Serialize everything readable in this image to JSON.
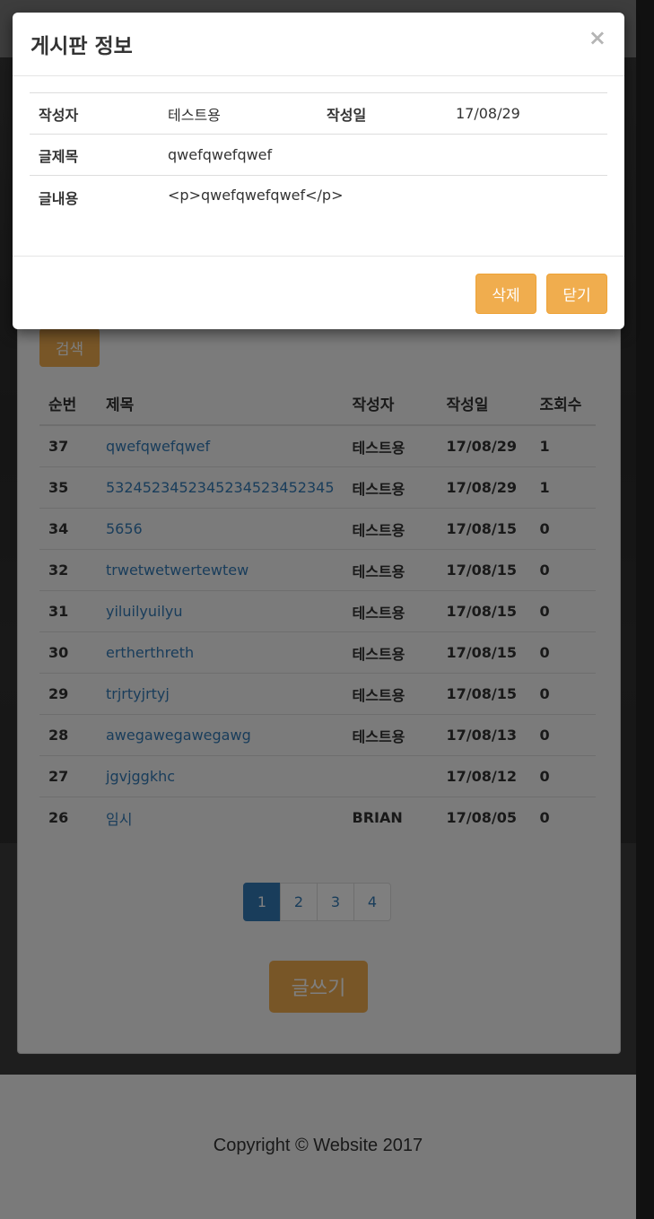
{
  "modal": {
    "title": "게시판 정보",
    "close_label": "×",
    "labels": {
      "writer": "작성자",
      "date": "작성일",
      "subject": "글제목",
      "content": "글내용"
    },
    "values": {
      "writer": "테스트용",
      "date": "17/08/29",
      "subject": "qwefqwefqwef",
      "content": "<p>qwefqwefqwef</p>"
    },
    "delete_label": "삭제",
    "close_button_label": "닫기"
  },
  "board": {
    "search_label": "검색",
    "columns": [
      "순번",
      "제목",
      "작성자",
      "작성일",
      "조회수"
    ],
    "rows": [
      [
        "37",
        "qwefqwefqwef",
        "테스트용",
        "17/08/29",
        "1"
      ],
      [
        "35",
        "5324523452345234523452345",
        "테스트용",
        "17/08/29",
        "1"
      ],
      [
        "34",
        "5656",
        "테스트용",
        "17/08/15",
        "0"
      ],
      [
        "32",
        "trwetwetwertewtew",
        "테스트용",
        "17/08/15",
        "0"
      ],
      [
        "31",
        "yiluilyuilyu",
        "테스트용",
        "17/08/15",
        "0"
      ],
      [
        "30",
        "ertherthreth",
        "테스트용",
        "17/08/15",
        "0"
      ],
      [
        "29",
        "trjrtyjrtyj",
        "테스트용",
        "17/08/15",
        "0"
      ],
      [
        "28",
        "awegawegawegawg",
        "테스트용",
        "17/08/13",
        "0"
      ],
      [
        "27",
        "jgvjggkhc",
        "",
        "17/08/12",
        "0"
      ],
      [
        "26",
        "임시",
        "BRIAN",
        "17/08/05",
        "0"
      ]
    ],
    "pages": [
      "1",
      "2",
      "3",
      "4"
    ],
    "write_label": "글쓰기"
  },
  "footer": {
    "copyright": "Copyright © Website 2017"
  },
  "colors": {
    "warning": "#f0ad4e",
    "primary": "#337ab7"
  }
}
